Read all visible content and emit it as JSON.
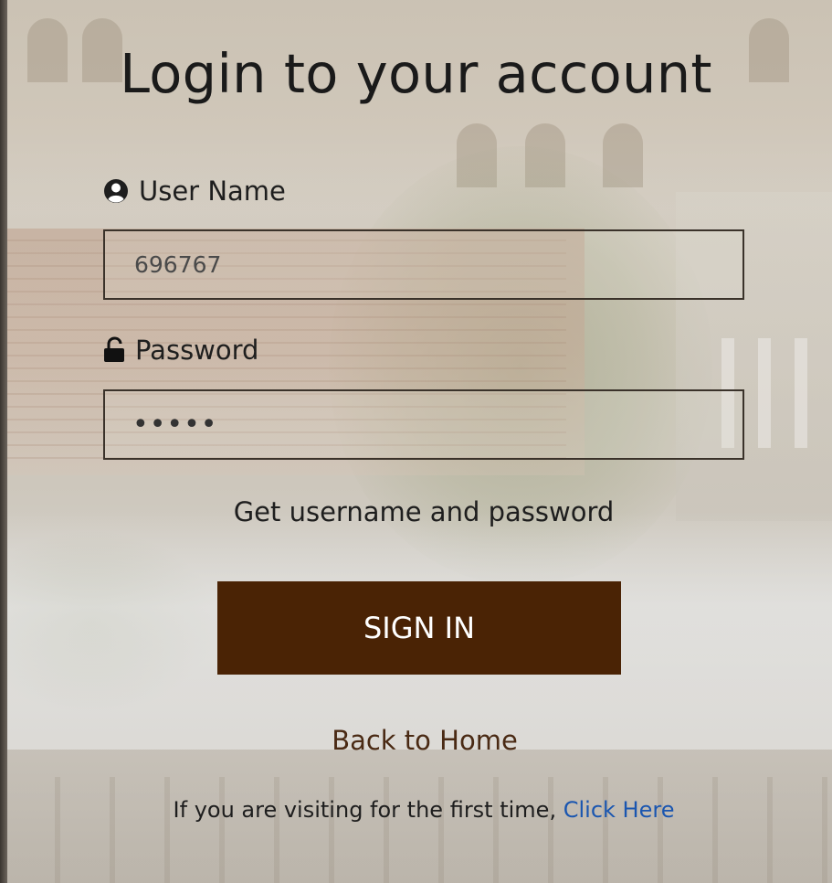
{
  "login": {
    "title": "Login to your account",
    "username_label": "User Name",
    "username_value": "696767",
    "password_label": "Password",
    "password_masked": "•••••",
    "get_credentials_link": "Get username and password",
    "sign_in_label": "SIGN IN",
    "back_home_link": "Back to Home",
    "first_time_text": "If you are visiting for the first time,",
    "first_time_link": "Click Here"
  },
  "icons": {
    "user": "user-circle-icon",
    "password": "unlock-icon"
  },
  "colors": {
    "sign_in_bg": "#4a2305",
    "link_blue": "#1a56b0",
    "back_home": "#4a2a14"
  }
}
